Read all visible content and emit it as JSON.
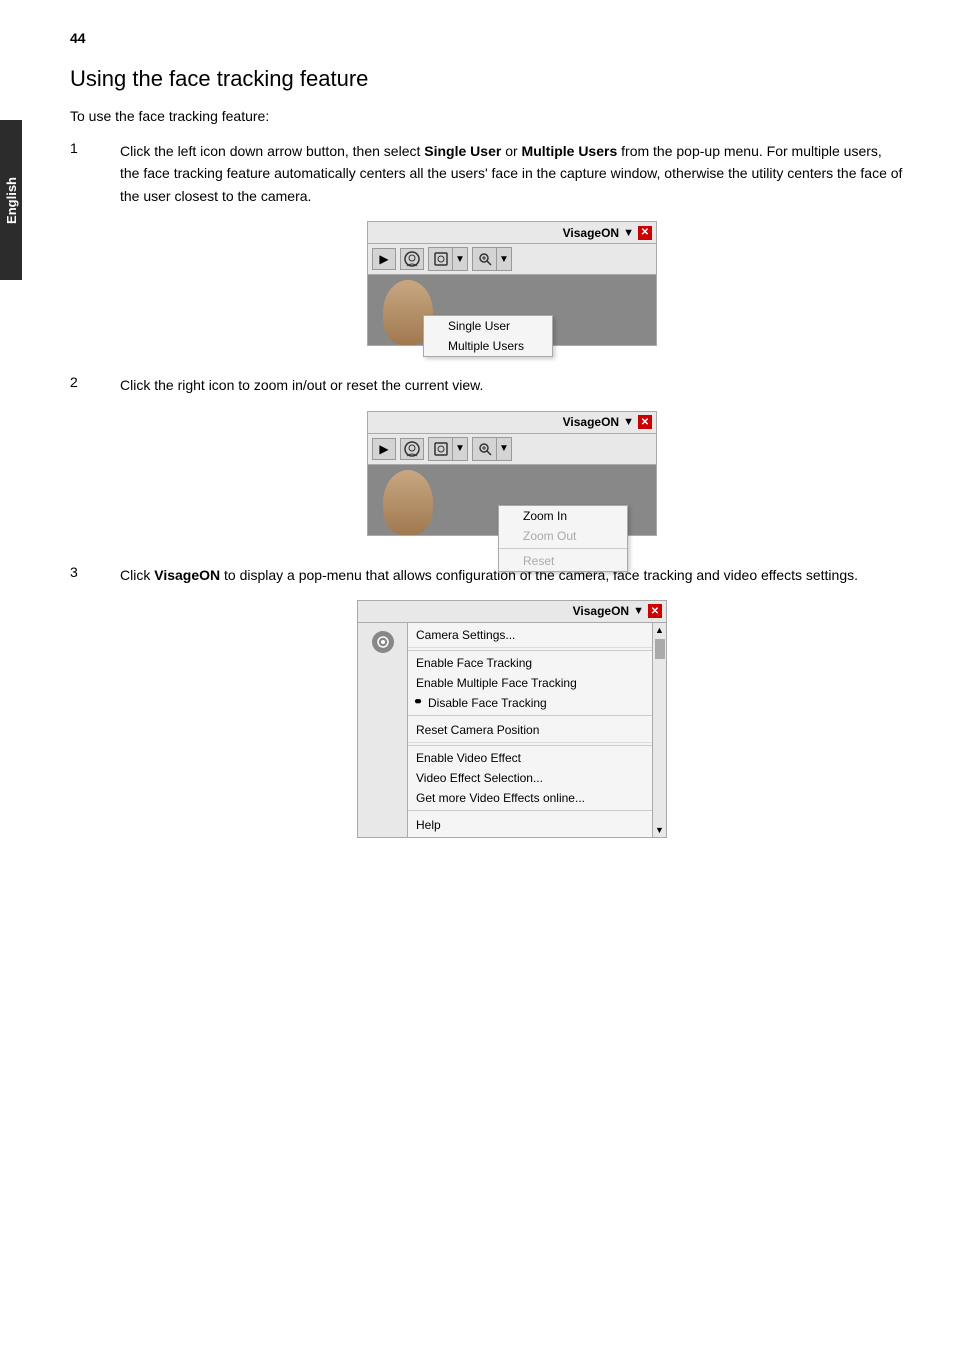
{
  "page": {
    "number": "44",
    "side_label": "English"
  },
  "title": "Using the face tracking feature",
  "intro": "To use the face tracking feature:",
  "steps": [
    {
      "number": "1",
      "text_parts": [
        "Click the left icon down arrow button, then select ",
        "Single User",
        " or ",
        "Multiple Users",
        " from the pop-up menu. For multiple users, the face tracking feature automatically centers all the users' face in the capture window, otherwise the utility centers the face of the user closest to the camera."
      ],
      "screenshot": {
        "titlebar": "VisageON",
        "dropdown_items": [
          "Single User",
          "Multiple Users"
        ]
      }
    },
    {
      "number": "2",
      "text": "Click the right icon to zoom in/out or reset the current view.",
      "screenshot": {
        "titlebar": "VisageON",
        "dropdown_items": [
          "Zoom In",
          "Zoom Out",
          "Reset"
        ],
        "disabled": [
          "Zoom Out",
          "Reset"
        ]
      }
    },
    {
      "number": "3",
      "text_parts": [
        "Click ",
        "VisageON",
        " to display a pop-menu that allows configuration of the camera, face tracking and video effects settings."
      ],
      "screenshot": {
        "titlebar": "VisageON",
        "menu_items": [
          {
            "label": "Camera Settings...",
            "type": "item"
          },
          {
            "type": "separator"
          },
          {
            "label": "Enable Face Tracking",
            "type": "item"
          },
          {
            "label": "Enable Multiple Face Tracking",
            "type": "item"
          },
          {
            "label": "Disable Face Tracking",
            "type": "bullet"
          },
          {
            "type": "separator"
          },
          {
            "label": "Reset Camera Position",
            "type": "item"
          },
          {
            "type": "separator"
          },
          {
            "label": "Enable Video Effect",
            "type": "item"
          },
          {
            "label": "Video Effect Selection...",
            "type": "item"
          },
          {
            "label": "Get more Video Effects online...",
            "type": "item"
          },
          {
            "type": "separator"
          },
          {
            "label": "Help",
            "type": "item"
          }
        ]
      }
    }
  ],
  "labels": {
    "visageon": "VisageON",
    "dropdown_arrow": "▼",
    "close": "✕",
    "single_user": "Single User",
    "multiple_users": "Multiple Users",
    "zoom_in": "Zoom In",
    "zoom_out": "Zoom Out",
    "reset": "Reset",
    "camera_settings": "Camera Settings...",
    "enable_face_tracking": "Enable Face Tracking",
    "enable_multiple_face_tracking": "Enable Multiple Face Tracking",
    "disable_face_tracking": "Disable Face Tracking",
    "reset_camera_position": "Reset Camera Position",
    "enable_video_effect": "Enable Video Effect",
    "video_effect_selection": "Video Effect Selection...",
    "get_more_video": "Get more Video Effects online...",
    "help": "Help"
  }
}
